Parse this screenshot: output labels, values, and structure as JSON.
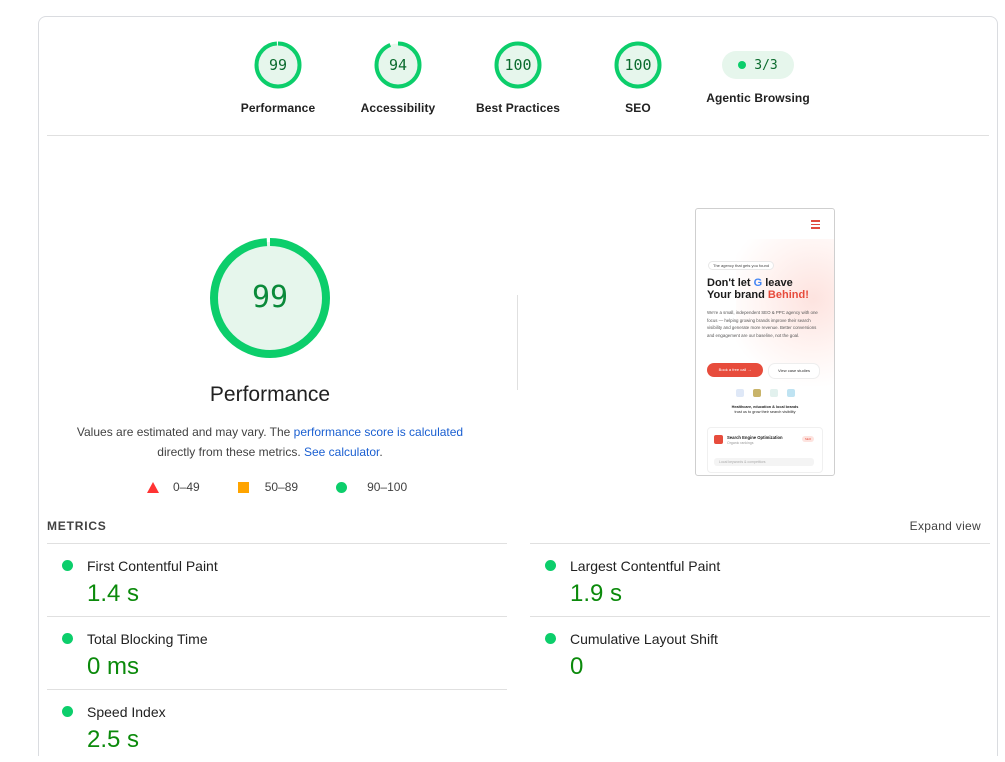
{
  "colors": {
    "pass_green": "#0cce6b",
    "score_text": "#0b8a3a",
    "link_blue": "#1a5fd1",
    "fail_red": "#ff3333",
    "average_orange": "#ffa400"
  },
  "category_scores": [
    {
      "score": "99",
      "value": 99,
      "label": "Performance"
    },
    {
      "score": "94",
      "value": 94,
      "label": "Accessibility"
    },
    {
      "score": "100",
      "value": 100,
      "label": "Best Practices"
    },
    {
      "score": "100",
      "value": 100,
      "label": "SEO"
    }
  ],
  "agentic": {
    "value": "3/3",
    "label": "Agentic Browsing"
  },
  "performance": {
    "score": "99",
    "value": 99,
    "title": "Performance",
    "desc_prefix": "Values are estimated and may vary. The ",
    "link_calc": "performance score is calculated",
    "desc_middle": " directly from these metrics. ",
    "link_calculator": "See calculator",
    "desc_suffix": "."
  },
  "legend": [
    {
      "range": "0–49",
      "shape": "triangle"
    },
    {
      "range": "50–89",
      "shape": "square"
    },
    {
      "range": "90–100",
      "shape": "circle"
    }
  ],
  "screenshot": {
    "tag": "The agency that gets you found",
    "headline_1": "Don't let ",
    "headline_g": "G",
    "headline_2": " leave",
    "headline_3": "Your brand ",
    "headline_red": "Behind!",
    "paragraph": "We're a small, independent SEO & PPC agency with one focus — helping growing brands improve their search visibility and generate more revenue. Better conversions and engagement are our baseline, not the goal.",
    "button_primary": "Book a free call →",
    "button_secondary": "View case studies",
    "logos_caption_1": "Healthcare, education & local brands",
    "logos_caption_2": "trust us to grow their search visibility",
    "card_title": "Search Engine Optimization",
    "card_sub": "Organic rankings",
    "card_badge": "SEO",
    "card_field": "Local keywords & competitors"
  },
  "metrics": {
    "heading": "METRICS",
    "expand_label": "Expand view",
    "left": [
      {
        "label": "First Contentful Paint",
        "value": "1.4 s"
      },
      {
        "label": "Total Blocking Time",
        "value": "0 ms"
      },
      {
        "label": "Speed Index",
        "value": "2.5 s"
      }
    ],
    "right": [
      {
        "label": "Largest Contentful Paint",
        "value": "1.9 s"
      },
      {
        "label": "Cumulative Layout Shift",
        "value": "0"
      }
    ]
  }
}
